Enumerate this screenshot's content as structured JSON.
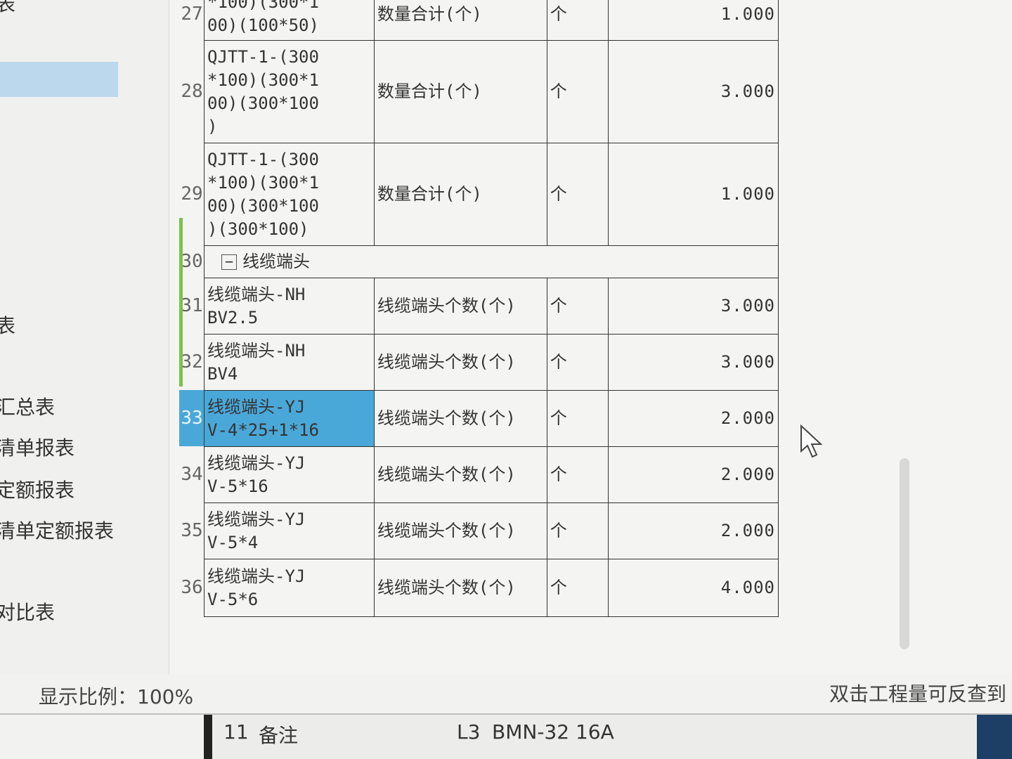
{
  "sidebar": {
    "items": [
      {
        "label": "表"
      },
      {
        "label": "表"
      },
      {
        "label": "汇总表"
      },
      {
        "label": "清单报表"
      },
      {
        "label": "定额报表"
      },
      {
        "label": "清单定额报表"
      },
      {
        "label": "对比表"
      }
    ]
  },
  "table": {
    "rows": [
      {
        "num": "27",
        "name": "*100)(300*1\n00)(100*50)",
        "desc": "数量合计(个)",
        "unit": "个",
        "qty": "1.000"
      },
      {
        "num": "28",
        "name": "QJTT-1-(300\n*100)(300*1\n00)(300*100\n)",
        "desc": "数量合计(个)",
        "unit": "个",
        "qty": "3.000"
      },
      {
        "num": "29",
        "name": "QJTT-1-(300\n*100)(300*1\n00)(300*100\n)(300*100)",
        "desc": "数量合计(个)",
        "unit": "个",
        "qty": "1.000"
      },
      {
        "num": "30",
        "group": true,
        "name": "线缆端头"
      },
      {
        "num": "31",
        "name": "线缆端头-NH\nBV2.5",
        "desc": "线缆端头个数(个)",
        "unit": "个",
        "qty": "3.000"
      },
      {
        "num": "32",
        "name": "线缆端头-NH\nBV4",
        "desc": "线缆端头个数(个)",
        "unit": "个",
        "qty": "3.000"
      },
      {
        "num": "33",
        "name": "线缆端头-YJ\nV-4*25+1*16",
        "desc": "线缆端头个数(个)",
        "unit": "个",
        "qty": "2.000",
        "selected": true
      },
      {
        "num": "34",
        "name": "线缆端头-YJ\nV-5*16",
        "desc": "线缆端头个数(个)",
        "unit": "个",
        "qty": "2.000"
      },
      {
        "num": "35",
        "name": "线缆端头-YJ\nV-5*4",
        "desc": "线缆端头个数(个)",
        "unit": "个",
        "qty": "2.000"
      },
      {
        "num": "36",
        "name": "线缆端头-YJ\nV-5*6",
        "desc": "线缆端头个数(个)",
        "unit": "个",
        "qty": "4.000"
      }
    ]
  },
  "status": {
    "zoom_label": "显示比例：100%",
    "hint": "双击工程量可反查到"
  },
  "bottom_bar": {
    "row_num": "11",
    "col_label": "备注",
    "code": "L3",
    "value": "BMN-32 16A"
  },
  "colors": {
    "selection": "#4aa8d8",
    "group_marker": "#7cc24a",
    "sidebar_highlight": "#bcd8ec"
  }
}
